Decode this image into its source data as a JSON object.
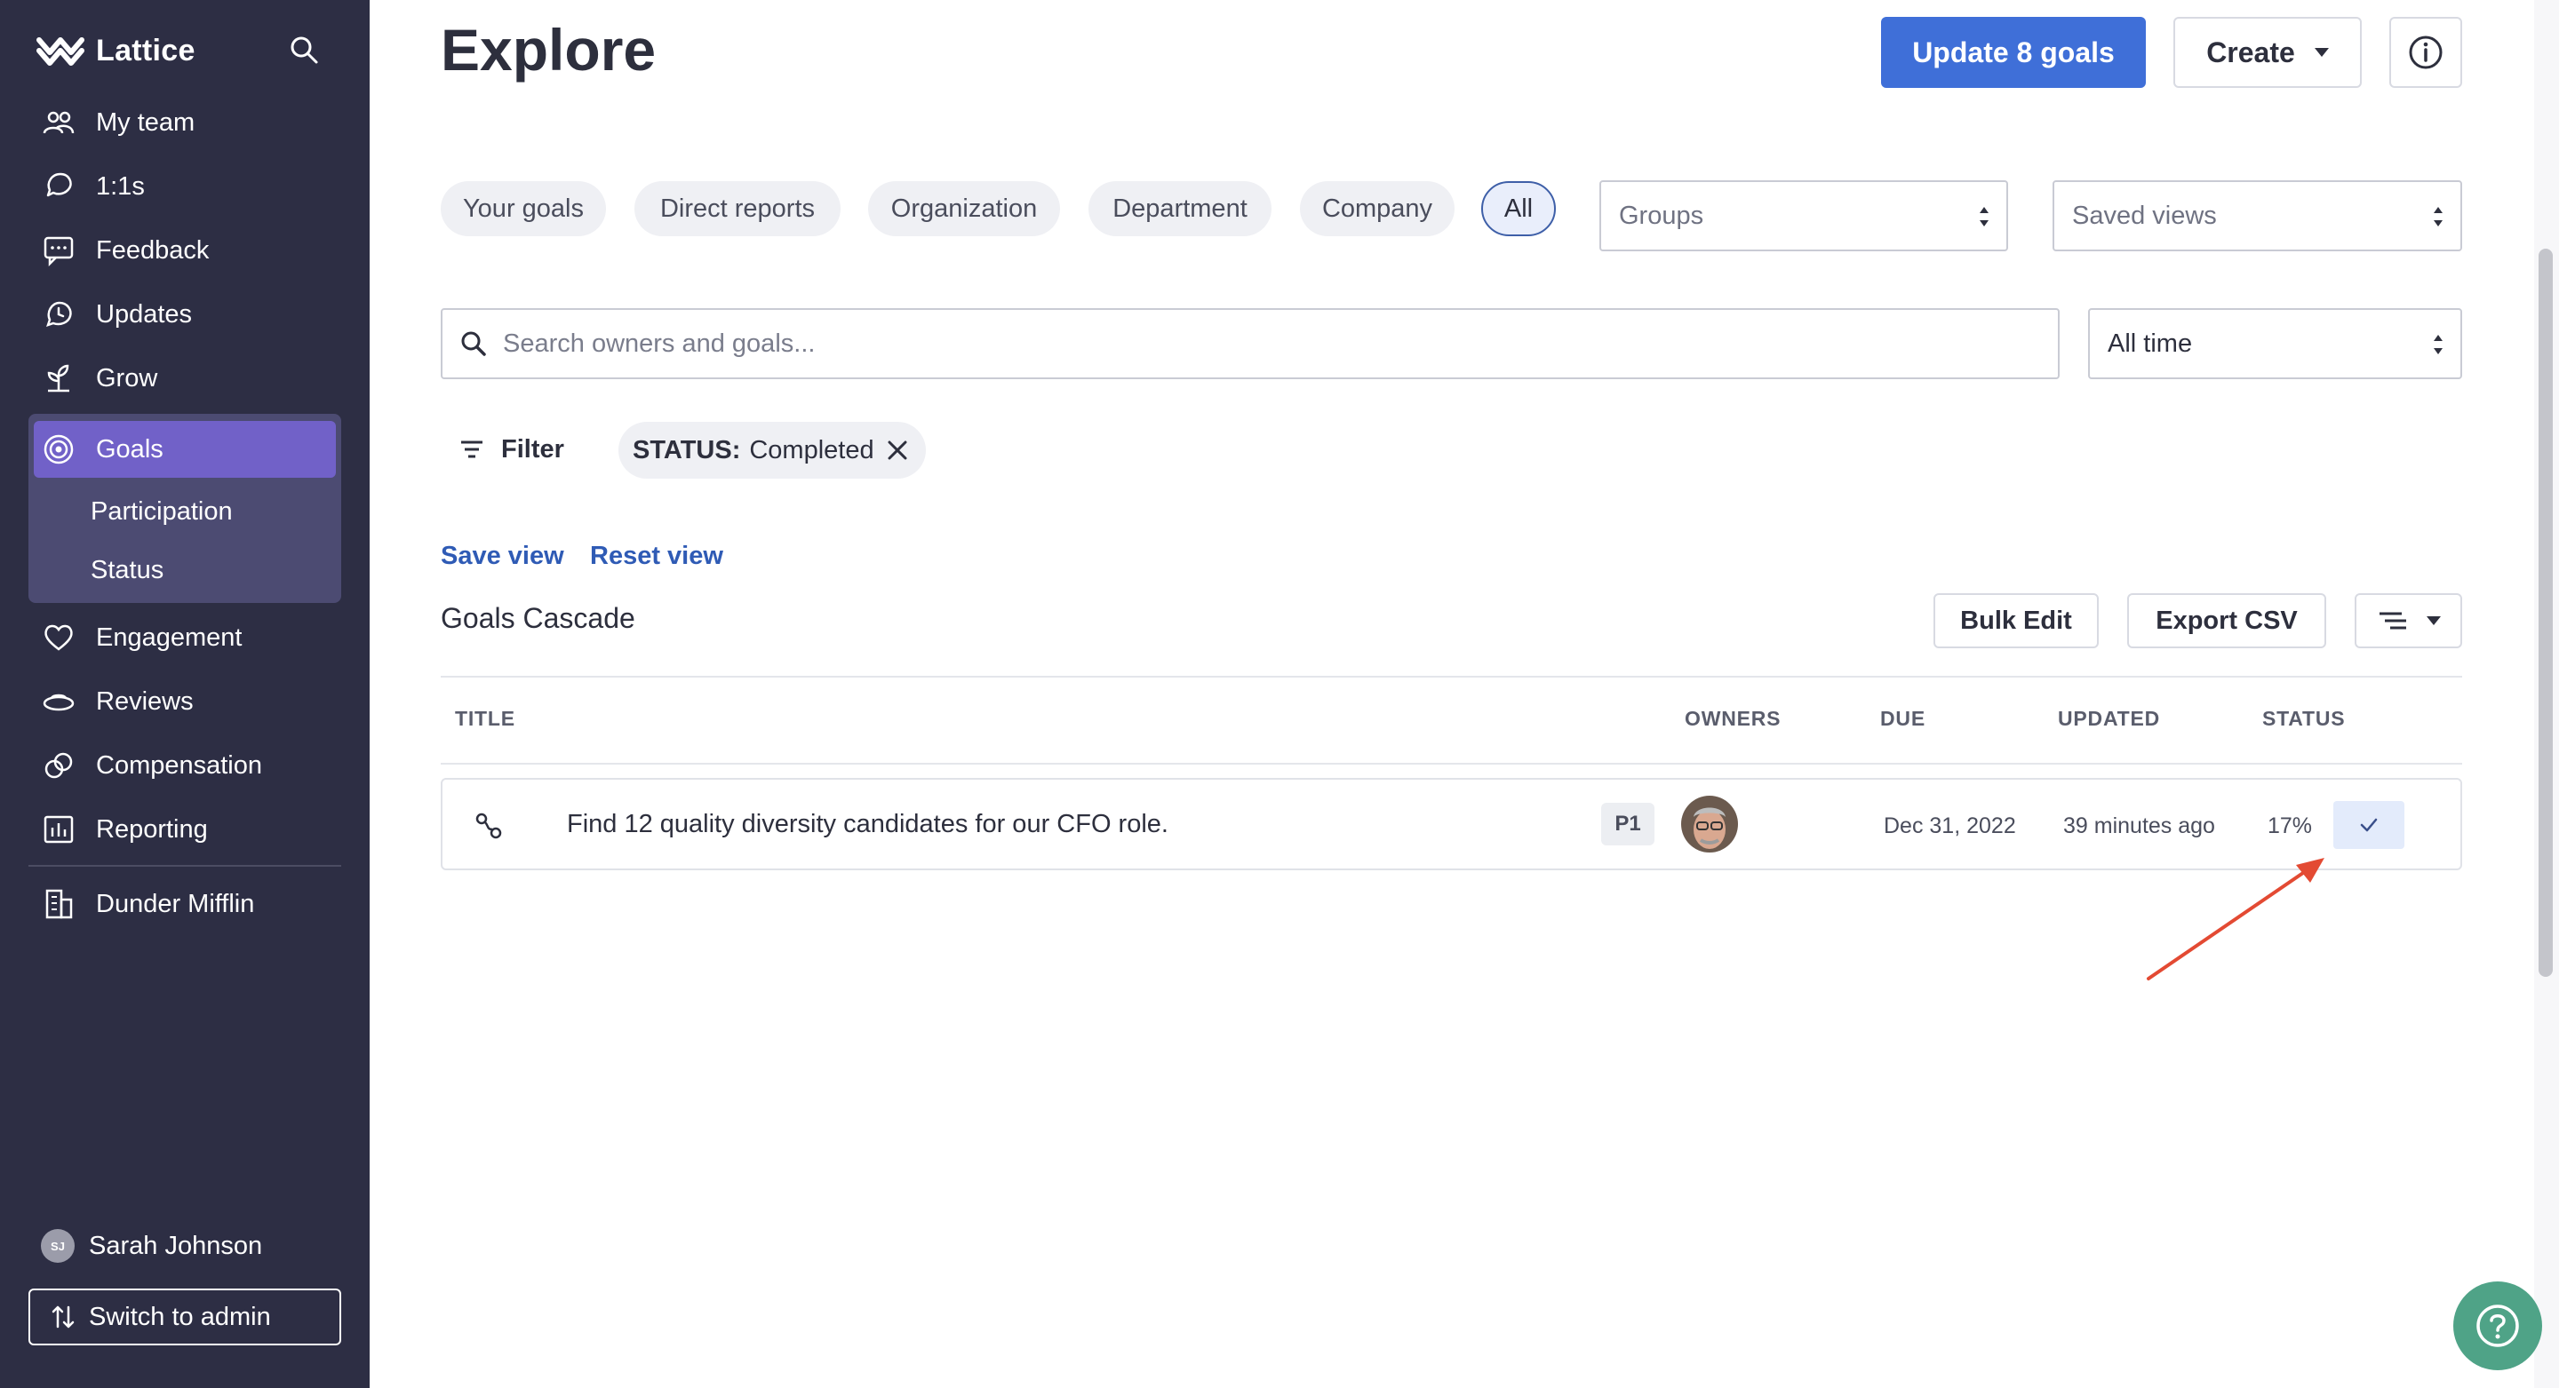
{
  "brand": {
    "name": "Lattice"
  },
  "sidebar": {
    "items": [
      {
        "label": "My team",
        "icon": "people-icon"
      },
      {
        "label": "1:1s",
        "icon": "chat-icon"
      },
      {
        "label": "Feedback",
        "icon": "feedback-icon"
      },
      {
        "label": "Updates",
        "icon": "updates-icon"
      },
      {
        "label": "Grow",
        "icon": "grow-icon"
      },
      {
        "label": "Goals",
        "icon": "target-icon"
      },
      {
        "label": "Engagement",
        "icon": "heart-icon"
      },
      {
        "label": "Reviews",
        "icon": "reviews-icon"
      },
      {
        "label": "Compensation",
        "icon": "coins-icon"
      },
      {
        "label": "Reporting",
        "icon": "chart-icon"
      },
      {
        "label": "Dunder Mifflin",
        "icon": "building-icon"
      }
    ],
    "goals_sub": [
      {
        "label": "Participation"
      },
      {
        "label": "Status"
      }
    ],
    "user": {
      "initials": "SJ",
      "name": "Sarah Johnson"
    },
    "switch_label": "Switch to admin"
  },
  "header": {
    "title": "Explore",
    "update_button": "Update 8 goals",
    "create_button": "Create"
  },
  "scope_tabs": [
    "Your goals",
    "Direct reports",
    "Organization",
    "Department",
    "Company",
    "All"
  ],
  "groups_select": {
    "value": "Groups"
  },
  "saved_views_select": {
    "value": "Saved views"
  },
  "search": {
    "placeholder": "Search owners and goals..."
  },
  "time_select": {
    "value": "All time"
  },
  "filter": {
    "button": "Filter",
    "chip_key": "STATUS:",
    "chip_value": "Completed"
  },
  "view_links": {
    "save": "Save view",
    "reset": "Reset view"
  },
  "section": {
    "title": "Goals Cascade",
    "bulk_edit": "Bulk Edit",
    "export_csv": "Export CSV"
  },
  "table": {
    "columns": [
      "TITLE",
      "OWNERS",
      "DUE",
      "UPDATED",
      "STATUS"
    ],
    "rows": [
      {
        "title": "Find 12 quality diversity candidates for our CFO role.",
        "priority": "P1",
        "due": "Dec 31, 2022",
        "updated": "39 minutes ago",
        "progress": "17%",
        "status": "completed"
      }
    ]
  },
  "colors": {
    "sidebar_bg": "#2d2e44",
    "sidebar_active": "#7161c8",
    "primary": "#3f6fd8",
    "link": "#2f5bb5",
    "help": "#4fa387",
    "annotation_arrow": "#e34a33"
  }
}
